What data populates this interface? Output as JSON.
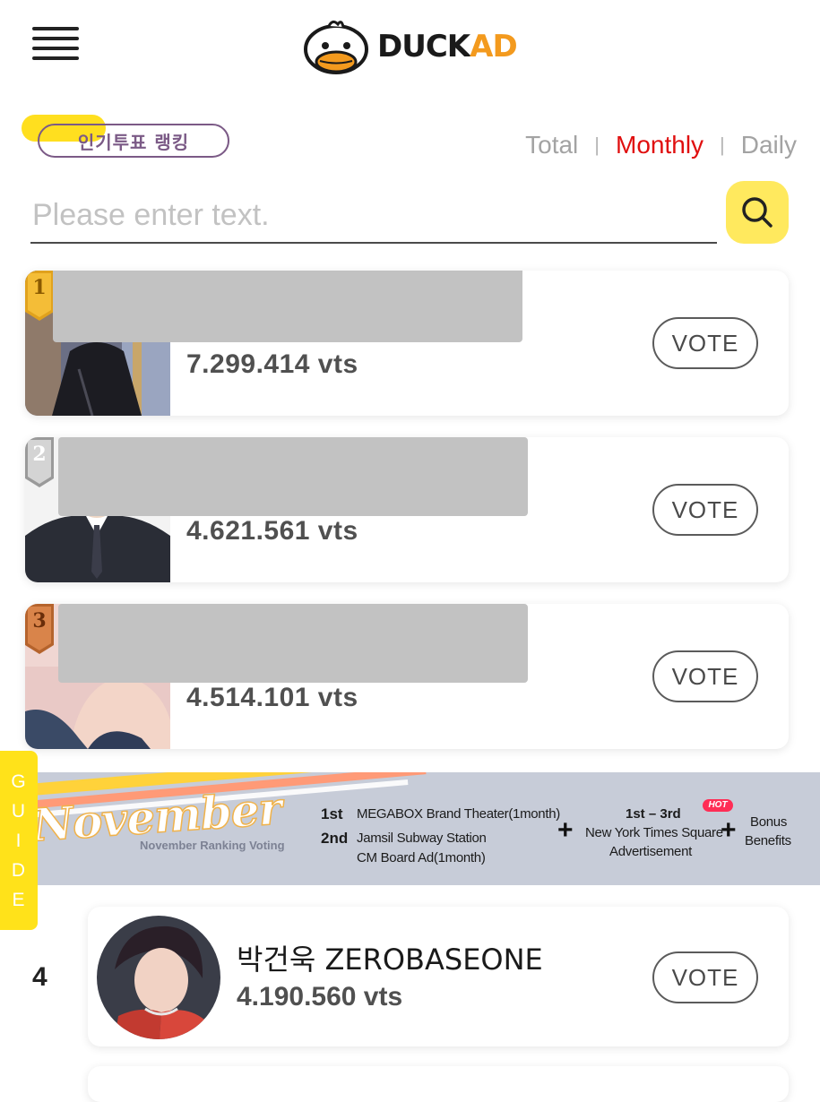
{
  "header": {
    "logo_duck": "DUCK",
    "logo_ad": "AD",
    "colors": {
      "logo_orange": "#f39a1e",
      "accent_yellow": "#ffe95e"
    }
  },
  "ranking": {
    "badge_label": "인기투표 랭킹",
    "tabs": [
      {
        "label": "Total",
        "active": false
      },
      {
        "label": "Monthly",
        "active": true
      },
      {
        "label": "Daily",
        "active": false
      }
    ],
    "tab_separator": "|"
  },
  "search": {
    "placeholder": "Please enter text.",
    "value": ""
  },
  "top_entries": [
    {
      "rank": "1",
      "votes": "7.299.414 vts",
      "vote_label": "VOTE",
      "medal": "gold"
    },
    {
      "rank": "2",
      "votes": "4.621.561 vts",
      "vote_label": "VOTE",
      "medal": "silver"
    },
    {
      "rank": "3",
      "votes": "4.514.101 vts",
      "vote_label": "VOTE",
      "medal": "bronze"
    }
  ],
  "banner": {
    "title": "November",
    "subtitle": "November Ranking Voting",
    "first_rank": "1st",
    "first_prize": "MEGABOX Brand Theater(1month)",
    "second_rank": "2nd",
    "second_prize_line1": "Jamsil Subway Station",
    "second_prize_line2": "CM Board Ad(1month)",
    "top3_rank": "1st – 3rd",
    "top3_badge": "HOT",
    "top3_prize_line1": "New York Times Square",
    "top3_prize_line2": "Advertisement",
    "bonus_line1": "Bonus",
    "bonus_line2": "Benefits",
    "plus": "+"
  },
  "guide": {
    "letters": [
      "G",
      "U",
      "I",
      "D",
      "E"
    ]
  },
  "list": [
    {
      "rank": "4",
      "name": "박건욱 ZEROBASEONE",
      "votes": "4.190.560 vts",
      "vote_label": "VOTE"
    }
  ]
}
